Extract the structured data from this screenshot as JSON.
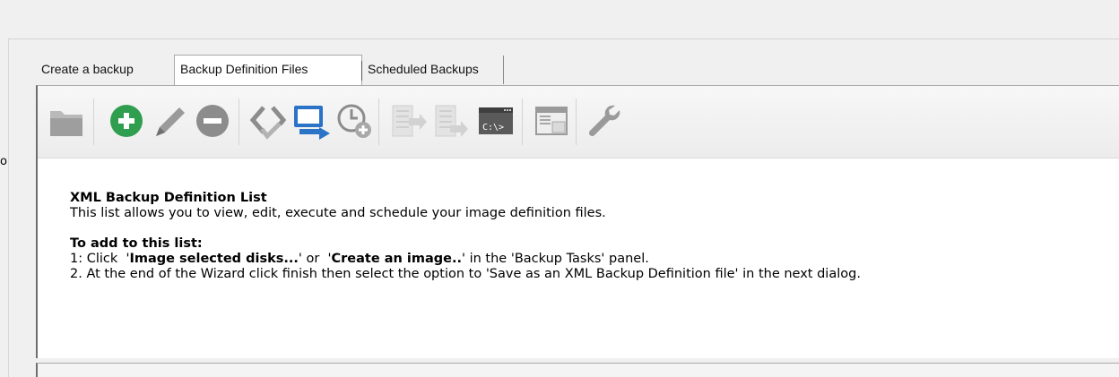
{
  "side": {
    "fragment": "o"
  },
  "tabs": [
    {
      "label": "Create a backup"
    },
    {
      "label": "Backup Definition Files"
    },
    {
      "label": "Scheduled Backups"
    }
  ],
  "toolbar": {
    "icons": [
      "open-folder-icon",
      "add-icon",
      "edit-pencil-icon",
      "remove-icon",
      "verify-xml-icon",
      "run-backup-icon",
      "schedule-add-icon",
      "script-export-icon",
      "script-import-icon",
      "command-line-icon",
      "window-view-icon",
      "settings-wrench-icon"
    ],
    "cmd_label": "C:\\>",
    "colors": {
      "green": "#2f9e4e",
      "blue": "#2a73c6",
      "gray": "#8c8c8c",
      "light_gray": "#c8c8c8"
    }
  },
  "content": {
    "heading": "XML Backup Definition List",
    "description": "This list allows you to view, edit, execute and schedule your image definition files.",
    "add_heading": "To add to this list:",
    "step1_prefix": "1: Click  '",
    "step1_bold1": "Image selected disks...",
    "step1_mid": "' or  '",
    "step1_bold2": "Create an image..",
    "step1_suffix": "' in the 'Backup Tasks' panel.",
    "step2": "2. At the end of the Wizard click finish then select the option to 'Save as an XML Backup Definition file' in the next dialog."
  }
}
